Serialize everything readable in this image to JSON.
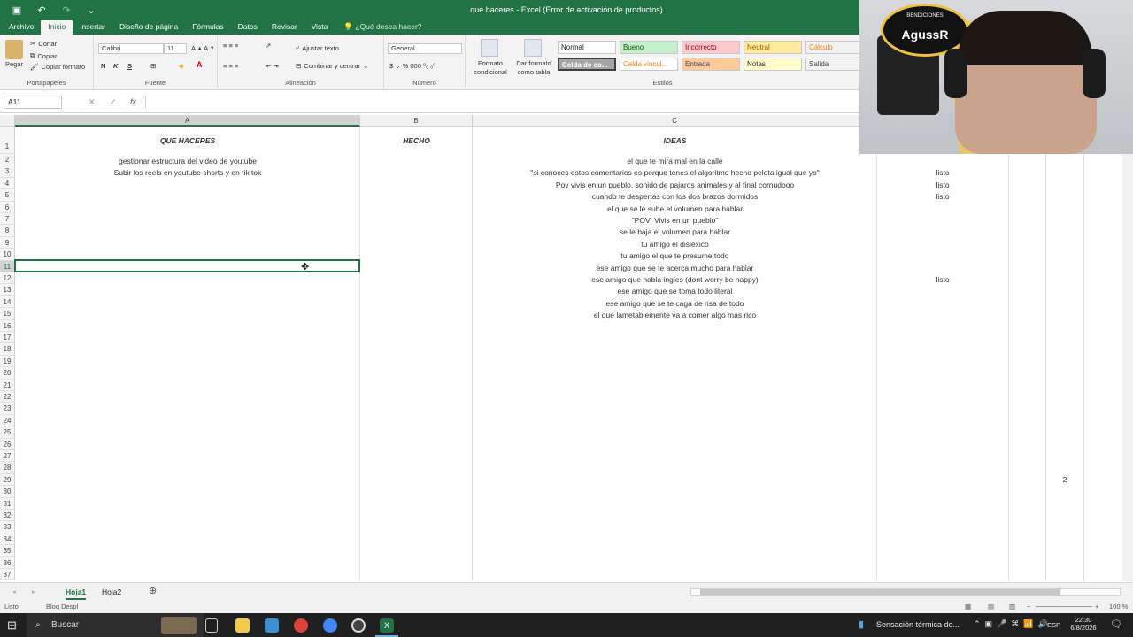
{
  "window": {
    "title": "que haceres - Excel (Error de activación de productos)"
  },
  "ribbon": {
    "tabs": [
      "Archivo",
      "Inicio",
      "Insertar",
      "Diseño de página",
      "Fórmulas",
      "Datos",
      "Revisar",
      "Vista"
    ],
    "tell_me": "¿Qué desea hacer?",
    "clipboard": {
      "paste": "Pegar",
      "cut": "Cortar",
      "copy": "Copiar",
      "format_painter": "Copiar formato",
      "label": "Portapapeles"
    },
    "font": {
      "name": "Calibri",
      "size": "11",
      "label": "Fuente"
    },
    "alignment": {
      "wrap": "Ajustar texto",
      "merge": "Combinar y centrar",
      "label": "Alineación"
    },
    "number": {
      "format": "General",
      "label": "Número"
    },
    "styles": {
      "conditional": "Formato condicional",
      "as_table": "Dar formato como tabla",
      "label": "Estilos",
      "cells": [
        "Normal",
        "Bueno",
        "Incorrecto",
        "Neutral",
        "Cálculo",
        "Celda de co...",
        "Celda vincul...",
        "Entrada",
        "Notas",
        "Salida"
      ]
    }
  },
  "formula_bar": {
    "name_box": "A11",
    "fx": "fx",
    "value": ""
  },
  "columns": [
    "A",
    "B",
    "C"
  ],
  "headers": {
    "a": "QUE HACERES",
    "b": "HECHO",
    "c": "IDEAS"
  },
  "col_a": [
    "gestionar estructura del video de youtube",
    "Subir los reels en youtube shorts y en tik tok"
  ],
  "ideas": [
    "el que te mira mal en la calle",
    "\"si conoces estos comentarios es porque tenes el algoritmo hecho pelota igual que yo\"",
    "Pov vivis en un pueblo, sonido de pajaros animales y al final cornudooo",
    "cuando te despertas con los dos brazos dormidos",
    "el que se le sube el volumen para hablar",
    "\"POV: Vivis en un pueblo\"",
    "se le baja el volumen para hablar",
    "tu amigo el dislexico",
    "tu amigo el que te presume todo",
    "ese amigo que se te acerca mucho para hablar",
    "ese amigo que habla ingles (dont worry be happy)",
    "ese amigo que se toma todo literal",
    "ese amigo que se te caga de risa de todo",
    "el que lametablemente va a comer algo mas rico"
  ],
  "status_d": [
    "",
    "listo",
    "listo",
    "listo",
    "",
    "",
    "",
    "",
    "",
    "",
    "listo",
    "",
    "",
    ""
  ],
  "stray_value": "2",
  "sheets": [
    "Hoja1",
    "Hoja2"
  ],
  "status": {
    "ready": "Listo",
    "scroll_lock": "Bloq Despl",
    "zoom": "100 %"
  },
  "taskbar": {
    "search": "Buscar",
    "weather": "Sensación térmica de...",
    "lang": "ESP",
    "time": "22:30",
    "date": "6/8/2026"
  },
  "cam": {
    "banner": "BENDICIONES",
    "name": "AgussR"
  }
}
